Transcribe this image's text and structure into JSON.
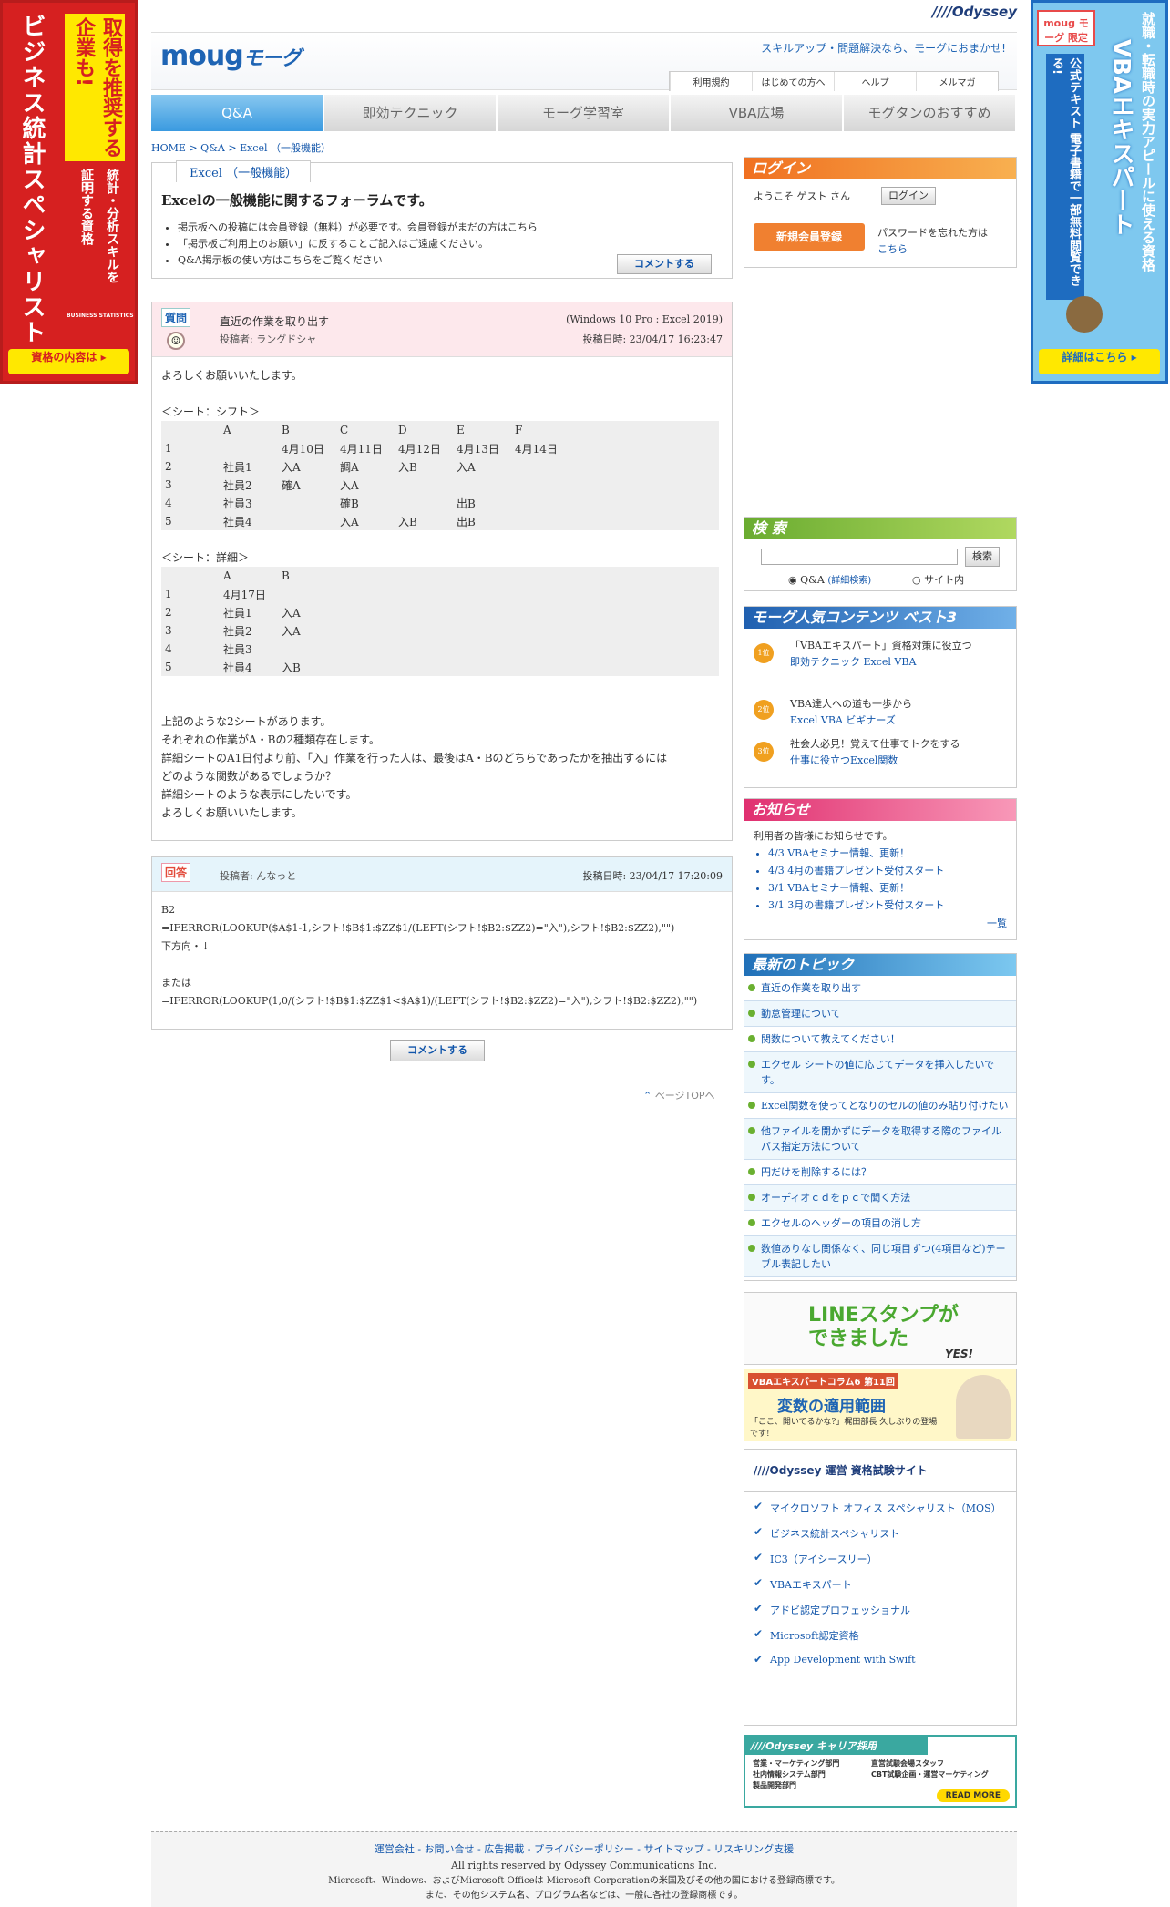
{
  "left_banner": {
    "title": "ビジネス統計スペシャリスト",
    "sub1": "取得を推奨する",
    "sub2": "企業も!",
    "sub3": "統計・分析スキルを",
    "sub4": "証明する資格",
    "logo": "BUSINESS STATISTICS",
    "button": "資格の内容は ▸"
  },
  "right_banner": {
    "badge": "moug モーグ 限定",
    "title": "VBAエキスパート",
    "sub1": "就職・転職時の実力アピールに使える資格",
    "sub2": "公式テキスト 電子書籍で一部無料閲覧できる!",
    "button": "詳細はこちら ▸"
  },
  "header": {
    "odyssey": "////Odyssey",
    "logo": "moug",
    "logo_kana": "モーグ",
    "tagline": "スキルアップ・問題解決なら、モーグにおまかせ!",
    "links": [
      "利用規約",
      "はじめての方へ",
      "ヘルプ",
      "メルマガ"
    ]
  },
  "nav": [
    "Q&A",
    "即効テクニック",
    "モーグ学習室",
    "VBA広場",
    "モグタンのおすすめ"
  ],
  "breadcrumb": "HOME > Q&A > Excel （一般機能）",
  "forum": {
    "tab": "Excel （一般機能）",
    "title": "Excelの一般機能に関するフォーラムです。",
    "notes": [
      "掲示板への投稿には会員登録（無料）が必要です。会員登録がまだの方はこちら",
      "「掲示板ご利用上のお願い」に反することご記入はご遠慮ください。",
      "Q&A掲示板の使い方はこちらをご覧ください"
    ],
    "comment_btn": "コメントする"
  },
  "question": {
    "badge": "質問",
    "title": "直近の作業を取り出す",
    "author": "投稿者: ラングドシャ",
    "env": "(Windows 10 Pro : Excel 2019)",
    "date": "投稿日時: 23/04/17 16:23:47",
    "intro": "よろしくお願いいたします。",
    "sheet1_label": "＜シート：シフト＞",
    "sheet1": [
      [
        "",
        "A",
        "B",
        "C",
        "D",
        "E",
        "F"
      ],
      [
        "1",
        "",
        "4月10日",
        "4月11日",
        "4月12日",
        "4月13日",
        "4月14日"
      ],
      [
        "2",
        "社員1",
        "入A",
        "調A",
        "入B",
        "入A",
        ""
      ],
      [
        "3",
        "社員2",
        "確A",
        "入A",
        "",
        "",
        ""
      ],
      [
        "4",
        "社員3",
        "",
        "確B",
        "",
        "出B",
        ""
      ],
      [
        "5",
        "社員4",
        "",
        "入A",
        "入B",
        "出B",
        ""
      ]
    ],
    "sheet2_label": "＜シート：詳細＞",
    "sheet2": [
      [
        "",
        "A",
        "B"
      ],
      [
        "1",
        "4月17日",
        ""
      ],
      [
        "2",
        "社員1",
        "入A"
      ],
      [
        "3",
        "社員2",
        "入A"
      ],
      [
        "4",
        "社員3",
        ""
      ],
      [
        "5",
        "社員4",
        "入B"
      ]
    ],
    "outro": [
      "上記のような2シートがあります。",
      "それぞれの作業がA・Bの2種類存在します。",
      "詳細シートのA1日付より前、「入」作業を行った人は、最後はA・Bのどちらであったかを抽出するには",
      "どのような関数があるでしょうか？",
      "詳細シートのような表示にしたいです。",
      "よろしくお願いいたします。"
    ]
  },
  "answer": {
    "badge": "回答",
    "author": "投稿者: んなっと",
    "date": "投稿日時: 23/04/17 17:20:09",
    "lines": [
      "B2",
      "=IFERROR(LOOKUP($A$1-1,シフト!$B$1:$ZZ$1/(LEFT(シフト!$B2:$ZZ2)=\"入\"),シフト!$B2:$ZZ2),\"\")",
      "下方向・↓",
      "",
      "または",
      "=IFERROR(LOOKUP(1,0/(シフト!$B$1:$ZZ$1<$A$1)/(LEFT(シフト!$B2:$ZZ2)=\"入\"),シフト!$B2:$ZZ2),\"\")"
    ]
  },
  "comment_btn": "コメントする",
  "page_top": "ページTOPへ",
  "login": {
    "title": "ログイン",
    "welcome": "ようこそ ゲスト さん",
    "login_btn": "ログイン",
    "register_btn": "新規会員登録",
    "forgot": "パスワードを忘れた方は",
    "here": "こちら"
  },
  "search": {
    "title": "検 索",
    "button": "検索",
    "opt1": "Q&A",
    "opt1_sub": "(詳細検索)",
    "opt2": "サイト内"
  },
  "best3": {
    "title": "モーグ人気コンテンツ ベスト3",
    "items": [
      {
        "rank": "1位",
        "title": "「VBAエキスパート」資格対策に役立つ",
        "link": "即効テクニック Excel VBA"
      },
      {
        "rank": "2位",
        "title": "VBA達人への道も一歩から",
        "link": "Excel VBA ビギナーズ"
      },
      {
        "rank": "3位",
        "title": "社会人必見！覚えて仕事でトクをする",
        "link": "仕事に役立つExcel関数"
      }
    ]
  },
  "news": {
    "title": "お知らせ",
    "lead": "利用者の皆様にお知らせです。",
    "items": [
      "4/3 VBAセミナー情報、更新！",
      "4/3 4月の書籍プレゼント受付スタート",
      "3/1 VBAセミナー情報、更新！",
      "3/1 3月の書籍プレゼント受付スタート"
    ],
    "more": "一覧"
  },
  "topics": {
    "title": "最新のトピック",
    "items": [
      "直近の作業を取り出す",
      "勤怠管理について",
      "関数について教えてください！",
      "エクセル シートの値に応じてデータを挿入したいです。",
      "Excel関数を使ってとなりのセルの値のみ貼り付けたい",
      "他ファイルを開かずにデータを取得する際のファイルパス指定方法について",
      "円だけを削除するには？",
      "オーディオｃｄをｐｃで聞く方法",
      "エクセルのヘッダーの項目の消し方",
      "数値ありなし関係なく、同じ項目ずつ(4項目など)テーブル表記したい"
    ]
  },
  "line_banner": {
    "text": "LINEスタンプができました",
    "yes": "YES!"
  },
  "vba_banner": {
    "head": "VBAエキスパートコラム6 第11回",
    "title": "変数の適用範囲",
    "sub": "「ここ、開いてるかな?」梶田部長 久しぶりの登場です!"
  },
  "odyssey_sites": {
    "title": "////Odyssey 運営 資格試験サイト",
    "items": [
      "マイクロソフト オフィス スペシャリスト（MOS）",
      "ビジネス統計スペシャリスト",
      "IC3（アイシースリー）",
      "VBAエキスパート",
      "アドビ認定プロフェッショナル",
      "Microsoft認定資格",
      "App Development with Swift"
    ]
  },
  "career": {
    "title": "////Odyssey キャリア採用",
    "items": [
      "営業・マーケティング部門",
      "社内情報システム部門",
      "製品開発部門",
      "直営試験会場スタッフ",
      "CBT試験企画・運営マーケティング"
    ],
    "more": "READ MORE"
  },
  "footer": {
    "links": "運営会社 - お問い合せ - 広告掲載 - プライバシーポリシー - サイトマップ - リスキリング支援",
    "rights": "All rights reserved by Odyssey Communications Inc.",
    "tm1": "Microsoft、Windows、およびMicrosoft Officeは Microsoft Corporationの米国及びその他の国における登録商標です。",
    "tm2": "また、その他システム名、プログラム名などは、一般に各社の登録商標です。"
  }
}
